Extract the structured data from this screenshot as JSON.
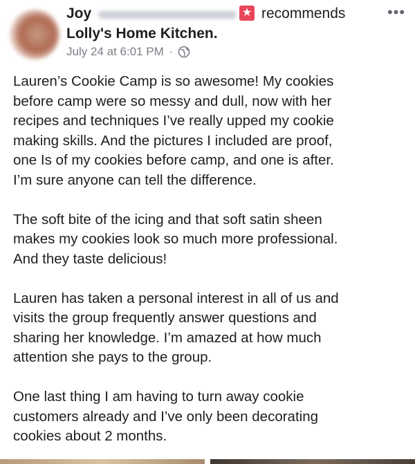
{
  "post": {
    "author_first_name": "Joy",
    "action_text": "recommends",
    "page_name": "Lolly's Home Kitchen.",
    "timestamp": "July 24 at 6:01 PM",
    "separator": "·",
    "more_label": "•••",
    "icons": {
      "avatar": "profile-photo",
      "recommend": "star-icon",
      "privacy": "globe-icon",
      "menu": "more-options-icon"
    },
    "colors": {
      "recommend_badge": "#e9455b",
      "meta_text": "#7a7f86",
      "body_text": "#1c1e21"
    },
    "paragraphs": [
      "Lauren’s Cookie Camp is so awesome!  My cookies\nbefore camp were so messy and dull, now with her\nrecipes and techniques I’ve really upped my cookie\nmaking skills.  And the pictures I included are proof,\none  Is of my cookies before camp, and one is after.\nI’m sure anyone can tell the difference.",
      "The soft bite of the icing and that soft satin sheen\nmakes my cookies look so much more professional.\nAnd they taste delicious!",
      "Lauren has taken a personal interest in all of us and\nvisits the group frequently answer questions and\nsharing her knowledge.  I’m amazed at how much\nattention she pays to the group.",
      "One last thing I am having to turn away cookie\ncustomers already and I’ve only been decorating\ncookies about 2 months."
    ]
  }
}
